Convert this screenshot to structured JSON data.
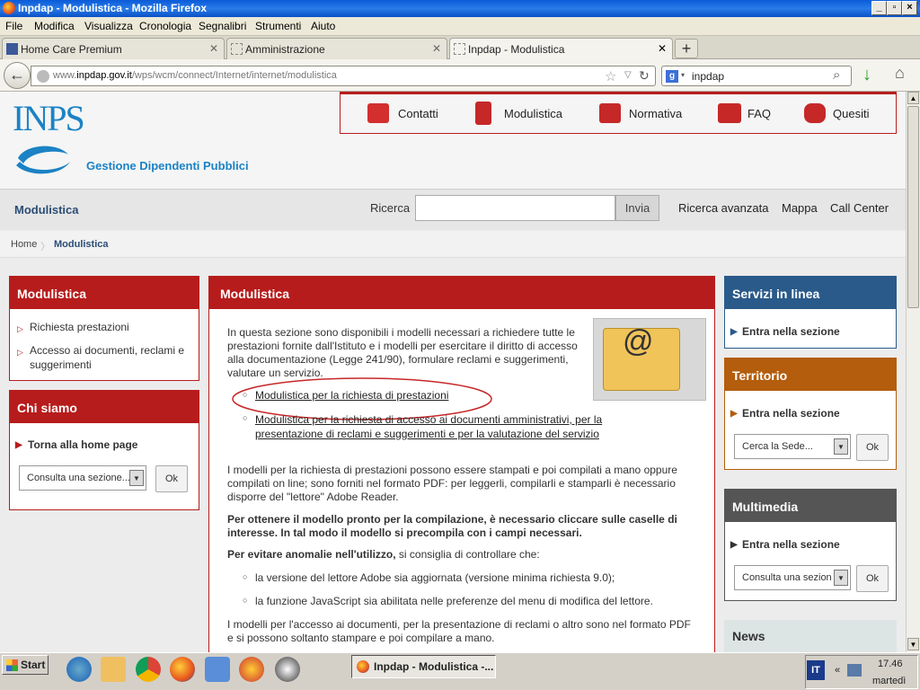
{
  "window": {
    "title": "Inpdap - Modulistica - Mozilla Firefox"
  },
  "menu": [
    "File",
    "Modifica",
    "Visualizza",
    "Cronologia",
    "Segnalibri",
    "Strumenti",
    "Aiuto"
  ],
  "tabs": [
    {
      "label": "Home Care Premium"
    },
    {
      "label": "Amministrazione"
    },
    {
      "label": "Inpdap - Modulistica"
    }
  ],
  "nav": {
    "url_prefix": "www.",
    "url_domain": "inpdap.gov.it",
    "url_path": "/wps/wcm/connect/Internet/internet/modulistica",
    "search_value": "inpdap"
  },
  "site": {
    "logo": "INPS",
    "logo_sub": "Gestione Dipendenti Pubblici",
    "topnav": [
      "Contatti",
      "Modulistica",
      "Normativa",
      "FAQ",
      "Quesiti"
    ],
    "section": "Modulistica",
    "search_label": "Ricerca",
    "search_button": "Invia",
    "links": [
      "Ricerca avanzata",
      "Mappa",
      "Call Center"
    ],
    "breadcrumb": [
      "Home",
      "Modulistica"
    ]
  },
  "left": {
    "box1_title": "Modulistica",
    "box1_items": [
      "Richiesta prestazioni",
      "Accesso ai documenti, reclami e suggerimenti"
    ],
    "box2_title": "Chi siamo",
    "box2_link": "Torna alla home page",
    "select": "Consulta una sezione...",
    "ok": "Ok"
  },
  "main": {
    "title": "Modulistica",
    "intro": "In questa sezione sono disponibili i modelli necessari a richiedere tutte le prestazioni fornite dall'Istituto e i modelli per esercitare il diritto di accesso alla documentazione (Legge 241/90), formulare reclami e suggerimenti, valutare un servizio.",
    "link1": "Modulistica per la richiesta di prestazioni",
    "link2": "Modulistica per la richiesta di accesso ai documenti amministrativi, per la presentazione di reclami e suggerimenti e per la valutazione del servizio",
    "p1": "I modelli per la richiesta di prestazioni possono essere stampati e poi compilati a mano oppure compilati on line; sono forniti nel formato PDF: per leggerli, compilarli e stamparli è necessario disporre del \"lettore\" Adobe Reader.",
    "p2": "Per ottenere il modello pronto per la compilazione, è necessario cliccare sulle caselle di interesse. In tal modo il modello si precompila con i campi necessari.",
    "p3_bold": "Per evitare anomalie nell'utilizzo,",
    "p3_rest": " si consiglia di controllare che:",
    "bullet1": "la versione del lettore Adobe sia aggiornata (versione minima richiesta 9.0);",
    "bullet2": "la funzione JavaScript sia abilitata nelle preferenze del menu di modifica del lettore.",
    "p4": "I modelli per l'accesso ai documenti, per la presentazione di reclami o altro sono nel formato PDF e si possono soltanto stampare e poi compilare a mano."
  },
  "right": {
    "servizi_title": "Servizi in linea",
    "servizi_link": "Entra nella sezione",
    "territorio_title": "Territorio",
    "territorio_link": "Entra nella sezione",
    "territorio_select": "Cerca la Sede...",
    "multimedia_title": "Multimedia",
    "multimedia_link": "Entra nella sezione",
    "multimedia_select": "Consulta una sezione",
    "news_title": "News",
    "ok": "Ok"
  },
  "taskbar": {
    "start": "Start",
    "item": "Inpdap - Modulistica -...",
    "lang": "IT",
    "time": "17.46",
    "day": "martedì"
  }
}
